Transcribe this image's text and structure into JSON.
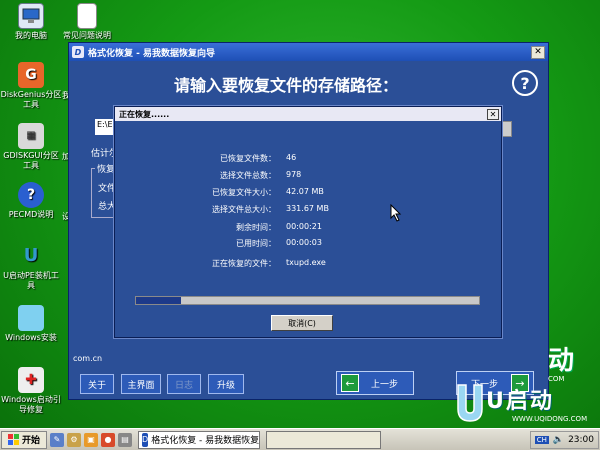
{
  "desktop_icons": [
    {
      "label": "我的电脑",
      "icon": "computer-icon"
    },
    {
      "label": "常见问题说明",
      "icon": "document-icon"
    },
    {
      "label": "DiskGenius分区工具",
      "icon": "diskgenius-icon"
    },
    {
      "label": "GDISKGUI分区工具",
      "icon": "gdisk-icon"
    },
    {
      "label": "PECMD说明",
      "icon": "help-icon"
    },
    {
      "label": "U启动PE装机工具",
      "icon": "uqidong-icon"
    },
    {
      "label": "Windows安装",
      "icon": "windows-install-icon"
    },
    {
      "label": "Windows启动引导修复",
      "icon": "boot-repair-icon"
    }
  ],
  "desktop_cutoff": [
    "我",
    "加",
    "设"
  ],
  "wizard": {
    "title": "格式化恢复 - 易我数据恢复向导",
    "heading": "请输入要恢复文件的存储路径：",
    "help_glyph": "?",
    "path_value": "E:\\E",
    "estimate_label": "估计尔",
    "group_title": "恢复",
    "group_line1": "文件",
    "group_line2": "总大",
    "url_fragment": "com.cn",
    "buttons": {
      "about": "关于",
      "main": "主界面",
      "log": "日志",
      "upgrade": "升级",
      "prev": "上一步",
      "next": "下一步"
    }
  },
  "dialog": {
    "title": "正在恢复......",
    "rows": [
      {
        "label": "已恢复文件数：",
        "value": "46"
      },
      {
        "label": "选择文件总数：",
        "value": "978"
      },
      {
        "label": "已恢复文件大小：",
        "value": "42.07 MB"
      },
      {
        "label": "选择文件总大小：",
        "value": "331.67 MB"
      },
      {
        "label": "剩余时间：",
        "value": "00:00:21"
      },
      {
        "label": "已用时间：",
        "value": "00:00:03"
      },
      {
        "label": "正在恢复的文件：",
        "value": "txupd.exe"
      }
    ],
    "progress": 0.13,
    "cancel": "取消(C)"
  },
  "brand": {
    "name": "U启动",
    "url": "WWW.UQIDONG.COM",
    "side_fragment": "动",
    "side_url": "COM"
  },
  "taskbar": {
    "start": "开始",
    "task1": "格式化恢复 - 易我数据恢复向导",
    "task2": "",
    "lang": "CH",
    "time": "23:00"
  },
  "colors": {
    "desktop": "#149a14",
    "window": "#2b4f97",
    "titlebar": "#1e4fb5",
    "progress_fill": "#1d3a8a"
  }
}
